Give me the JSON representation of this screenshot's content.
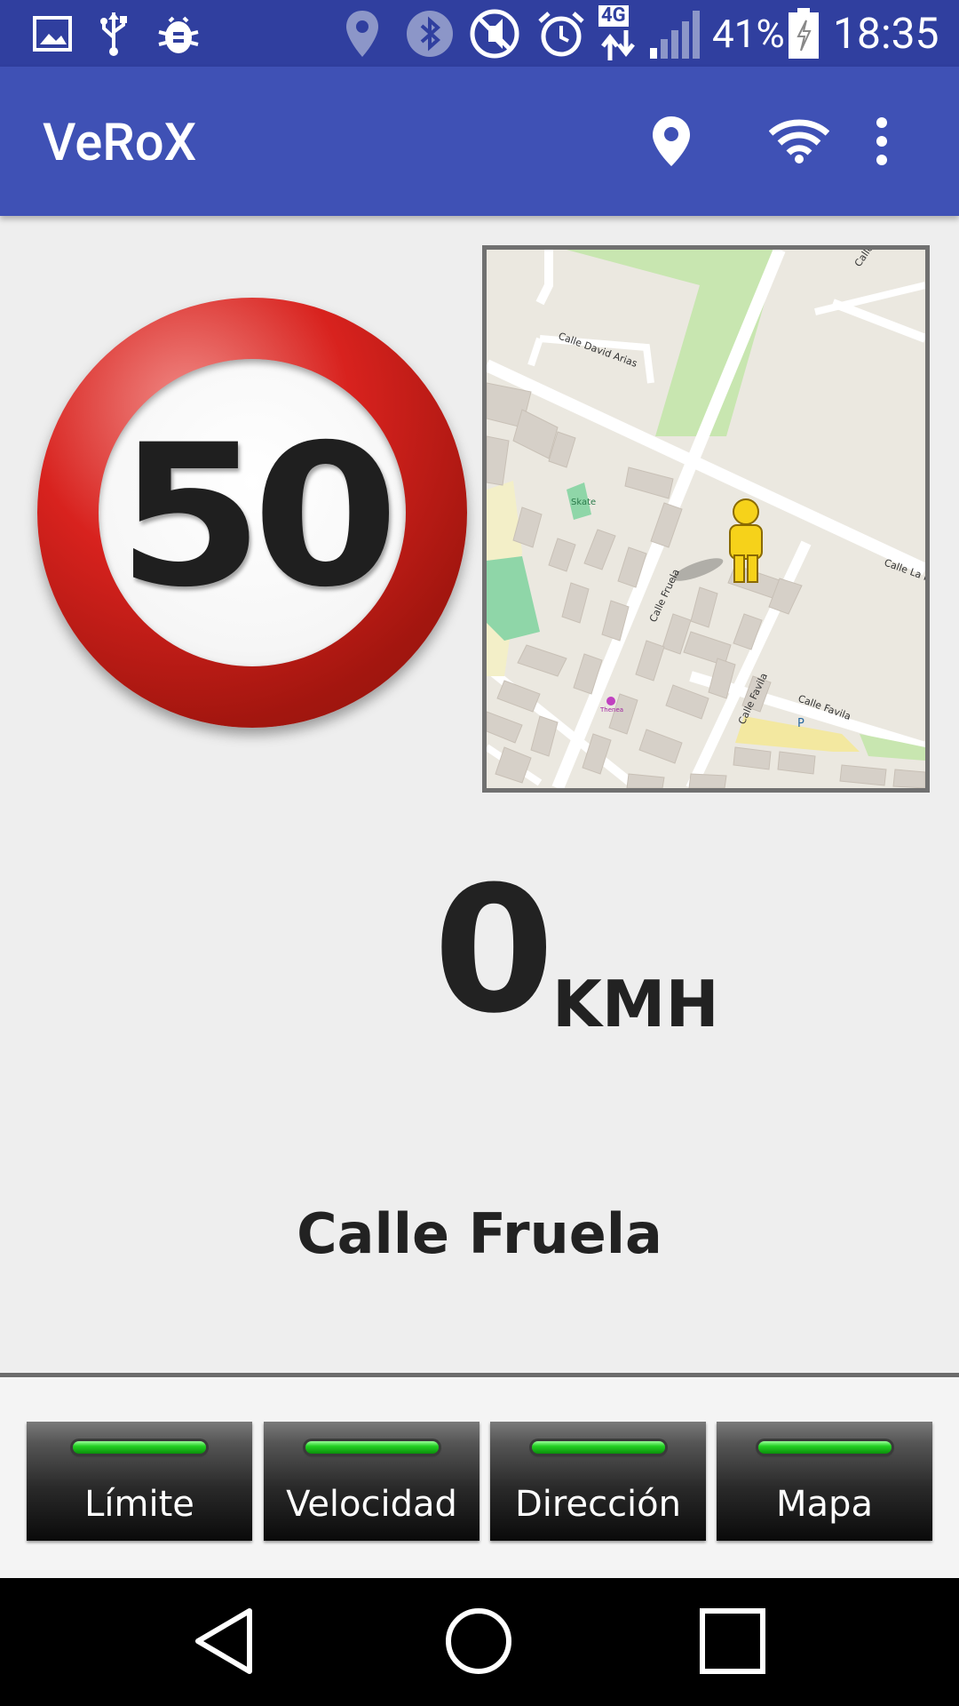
{
  "status_bar": {
    "battery_percent": "41%",
    "time": "18:35",
    "network_type": "4G",
    "icons": [
      "image-icon",
      "usb-icon",
      "bug-icon",
      "location-icon",
      "bluetooth-icon",
      "mute-icon",
      "alarm-icon",
      "signal-icon",
      "battery-icon"
    ]
  },
  "app_bar": {
    "title": "VeRoX",
    "actions": [
      "location-pin-icon",
      "wifi-icon",
      "overflow-menu-icon"
    ]
  },
  "speed_limit": {
    "value": "50"
  },
  "map": {
    "labels": [
      "Calle David Arias",
      "Skate",
      "Calle Fruela",
      "Calle Favila",
      "Calle Favila",
      "Calle La F",
      "Calle",
      "Thenea",
      "P"
    ]
  },
  "speed": {
    "value": "0",
    "unit": "KMH"
  },
  "street_name": "Calle Fruela",
  "tabs": [
    {
      "label": "Límite"
    },
    {
      "label": "Velocidad"
    },
    {
      "label": "Dirección"
    },
    {
      "label": "Mapa"
    }
  ],
  "colors": {
    "status_bar": "#303f9f",
    "app_bar": "#3f51b5",
    "led_green": "#22d022",
    "sign_red": "#d8221e"
  }
}
